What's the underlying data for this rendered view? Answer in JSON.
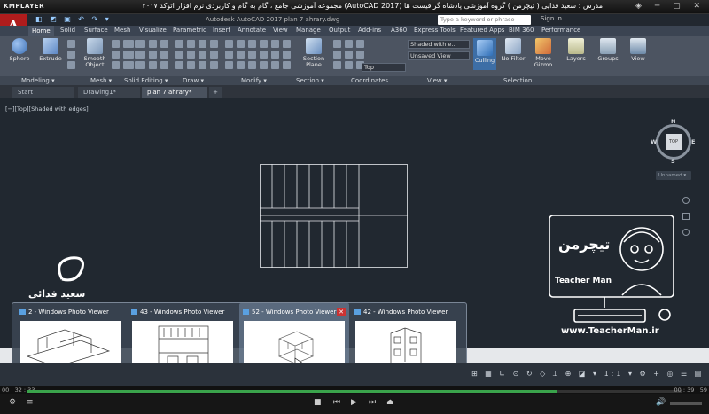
{
  "player": {
    "logo": "KMPLAYER",
    "title": "مجموعه آموزشی جامع ، گام به گام و کاربردی نرم افزار   اتوکد ۲۰۱۷ (AutoCAD 2017)   مدرس : سعید فدایی ( تیچرمن ) گروه آموزشی پادشاه گرافیست ها",
    "window_buttons": "◈ ─ ▢ ✕"
  },
  "autocad": {
    "app_letter": "A",
    "doc_title": "Autodesk AutoCAD 2017    plan 7 ahrary.dwg",
    "search_placeholder": "Type a keyword or phrase",
    "signin": "Sign In",
    "qat": "◧ ◩ ▣ ↶ ↷ ▾"
  },
  "tabs": [
    "Home",
    "Solid",
    "Surface",
    "Mesh",
    "Visualize",
    "Parametric",
    "Insert",
    "Annotate",
    "View",
    "Manage",
    "Output",
    "Add-ins",
    "A360",
    "Express Tools",
    "Featured Apps",
    "BIM 360",
    "Performance"
  ],
  "ribbon": {
    "sphere": "Sphere",
    "extrude": "Extrude",
    "smooth_object": "Smooth\nObject",
    "section_plane": "Section\nPlane",
    "culling": "Culling",
    "no_filter": "No Filter",
    "move_gizmo": "Move\nGizmo",
    "layers": "Layers",
    "groups": "Groups",
    "view": "View",
    "visual_style": "Shaded with e...",
    "view_dropdown": "Unsaved View",
    "ucs_dropdown": "Top"
  },
  "panels": [
    "Modeling ▾",
    "Mesh ▾",
    "Solid Editing ▾",
    "Draw ▾",
    "Modify ▾",
    "Section ▾",
    "Coordinates",
    "View ▾",
    "Selection"
  ],
  "file_tabs": [
    "Start",
    "Drawing1*",
    "plan 7 ahrary*"
  ],
  "viewport_label": "[−][Top][Shaded with edges]",
  "viewcube": {
    "top": "TOP",
    "n": "N",
    "s": "S",
    "e": "E",
    "w": "W",
    "unnamed": "Unnamed ▾"
  },
  "watermark": {
    "site": "www.TeacherMan.ir",
    "brand": "Teacher Man",
    "signature": "سعید فدائی"
  },
  "thumbnails": [
    {
      "title": "2 - Windows Photo Viewer"
    },
    {
      "title": "43 - Windows Photo Viewer"
    },
    {
      "title": "52 - Windows Photo Viewer"
    },
    {
      "title": "42 - Windows Photo Viewer"
    }
  ],
  "status": {
    "icons": "⊞ ▦ ∟ ⊙ ↻ ◇ ⟂ ⊕ ◪ ▾ 1:1 ▾ ⚙ + ◎ ☰ ▤"
  },
  "seek": {
    "elapsed": "00 : 32 : 33",
    "total": "00 : 39 : 59",
    "progress": 0.81
  },
  "colors": {
    "accent": "#b01c1c",
    "viewport": "#212830",
    "progress": "#3aa34b"
  }
}
